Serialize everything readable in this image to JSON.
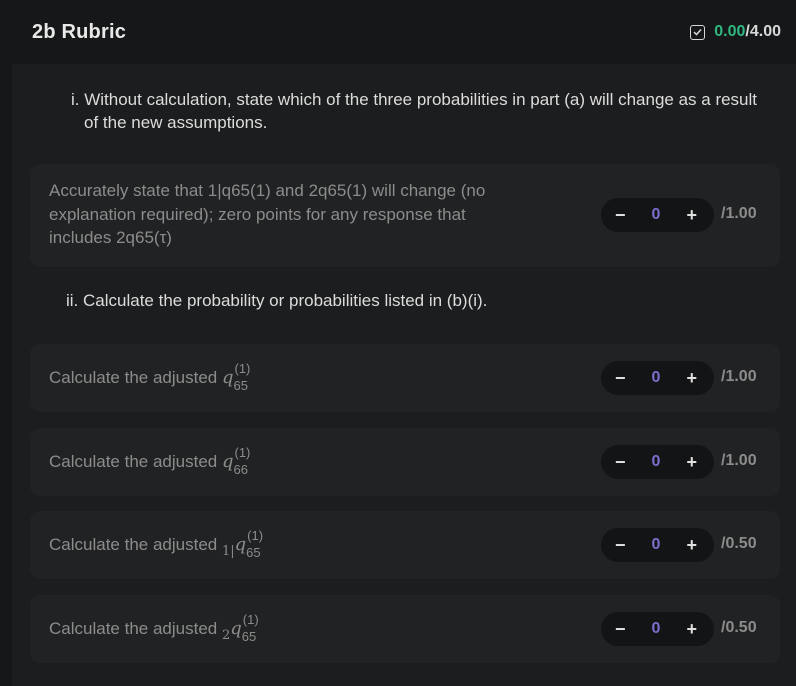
{
  "header": {
    "title": "2b Rubric",
    "score_value": "0.00",
    "score_total": "/4.00",
    "score_icon": "check-square-icon"
  },
  "questions": [
    {
      "text": "i. Without calculation, state which of the three probabilities in part (a) will change as a result of the new assumptions."
    },
    {
      "text": "ii. Calculate the probability or probabilities listed in (b)(i)."
    }
  ],
  "items": [
    {
      "text": "Accurately state that 1|q65(1) and 2q65(1) will change (no explanation required); zero points for any response that includes 2q65(τ)",
      "value": "0",
      "max": "/1.00"
    },
    {
      "text": "Calculate the adjusted ",
      "pre": "",
      "symbol": "q",
      "sup": "(1)",
      "sub": "65",
      "value": "0",
      "max": "/1.00"
    },
    {
      "text": "Calculate the adjusted ",
      "pre": "",
      "symbol": "q",
      "sup": "(1)",
      "sub": "66",
      "value": "0",
      "max": "/1.00"
    },
    {
      "text": "Calculate the adjusted ",
      "pre": "1|",
      "symbol": "q",
      "sup": "(1)",
      "sub": "65",
      "value": "0",
      "max": "/0.50"
    },
    {
      "text": "Calculate the adjusted ",
      "pre": "2",
      "symbol": "q",
      "sup": "(1)",
      "sub": "65",
      "value": "0",
      "max": "/0.50"
    }
  ],
  "stepper": {
    "minus": "−",
    "plus": "+"
  },
  "colors": {
    "background": "#161718",
    "score_green": "#2fb880",
    "stepper_value": "#7a6fcf"
  }
}
